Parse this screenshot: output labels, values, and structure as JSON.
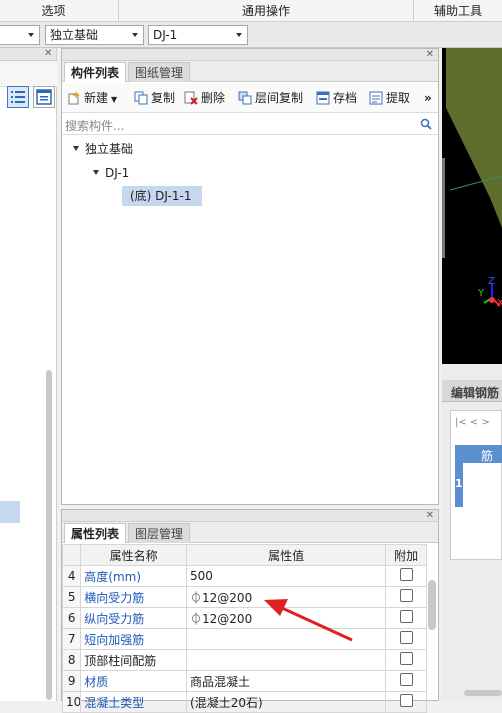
{
  "top_tabs": [
    "选项",
    "通用操作",
    "辅助工具"
  ],
  "selectors": {
    "type_value": "独立基础",
    "name_value": "DJ-1"
  },
  "component_panel": {
    "tabs": [
      "构件列表",
      "图纸管理"
    ],
    "toolbar": [
      "新建",
      "复制",
      "删除",
      "层间复制",
      "存档",
      "提取"
    ],
    "more_glyph": "»",
    "search_placeholder": "搜索构件...",
    "tree": {
      "root": "独立基础",
      "child": "DJ-1",
      "leaf": "(底) DJ-1-1"
    }
  },
  "property_panel": {
    "tabs": [
      "属性列表",
      "图层管理"
    ],
    "headers": [
      "属性名称",
      "属性值",
      "附加"
    ],
    "rows": [
      {
        "num": "4",
        "name": "高度(mm)",
        "value": "500"
      },
      {
        "num": "5",
        "name": "横向受力筋",
        "value": "⏀12@200"
      },
      {
        "num": "6",
        "name": "纵向受力筋",
        "value": "⏀12@200"
      },
      {
        "num": "7",
        "name": "短向加强筋",
        "value": ""
      },
      {
        "num": "8",
        "name": "顶部柱间配筋",
        "value": ""
      },
      {
        "num": "9",
        "name": "材质",
        "value": "商品混凝土"
      },
      {
        "num": "10",
        "name": "混凝土类型",
        "value": "(混凝土20石)"
      }
    ]
  },
  "right_panel": {
    "title": "编辑钢筋",
    "grid_header": "筋号",
    "row_num": "1",
    "nav": "|<  <  >"
  },
  "viewport": {
    "axis_x": "X",
    "axis_y": "Y",
    "axis_z": "Z"
  },
  "colors": {
    "accent_arrow": "#e02020",
    "selected_row": "#c5d8f0",
    "blue_text": "#2058b8"
  }
}
